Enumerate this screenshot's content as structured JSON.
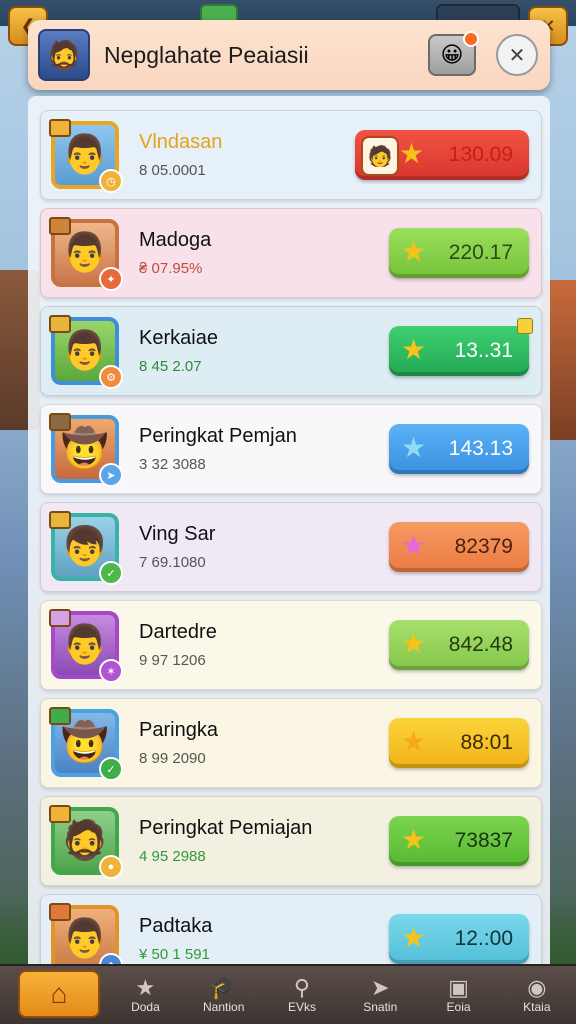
{
  "header": {
    "title": "Nepglahate Peaiasii"
  },
  "colors": {
    "row_blue": "#e6f0f8",
    "row_pink": "#f8e1ea",
    "row_cyan": "#deedf3",
    "row_white": "#f8f8fb",
    "row_lilac": "#f1e8f5",
    "row_cream": "#fbf8ea",
    "row_yellow": "#fbf6e3",
    "row_sand": "#f3f0e2",
    "row_aqua": "#e3eef6",
    "btn_red": "#e8453a",
    "btn_lime": "#8cd44b",
    "btn_green": "#3bc56a",
    "btn_blue": "#4aa3ef",
    "btn_orange": "#f28e55",
    "btn_yellow": "#f9c92b",
    "btn_cyan": "#6fd0e6"
  },
  "players": [
    {
      "name": "Vlndasan",
      "sub": "8 05.0001",
      "score": "130.09",
      "star_icon": "gold-star-icon"
    },
    {
      "name": "Madoga",
      "sub": "₴ 07.95%",
      "score": "220.17",
      "star_icon": "gold-star-icon"
    },
    {
      "name": "Kerkaiae",
      "sub": "8 45 2.07",
      "score": "13..31",
      "star_icon": "gold-star-icon"
    },
    {
      "name": "Peringkat Pemjan",
      "sub": "3 32 3088",
      "score": "143.13",
      "star_icon": "blue-star-icon"
    },
    {
      "name": "Ving Sar",
      "sub": "7 69.1080",
      "score": "82379",
      "star_icon": "pink-star-icon"
    },
    {
      "name": "Dartedre",
      "sub": "9 97 1206",
      "score": "842.48",
      "star_icon": "gold-star-icon"
    },
    {
      "name": "Paringka",
      "sub": "8 99 2090",
      "score": "88:01",
      "star_icon": "gold-star-icon"
    },
    {
      "name": "Peringkat Pemiajan",
      "sub": "4 95 2988",
      "score": "73837",
      "star_icon": "gold-star-icon"
    },
    {
      "name": "Padtaka",
      "sub": "¥ 50 1 591",
      "score": "12.:00",
      "star_icon": "gold-star-icon"
    }
  ],
  "nav": [
    {
      "label": "",
      "icon": "home-icon"
    },
    {
      "label": "Doda",
      "icon": "star-icon"
    },
    {
      "label": "Nantion",
      "icon": "hat-icon"
    },
    {
      "label": "EVks",
      "icon": "search-icon"
    },
    {
      "label": "Snatin",
      "icon": "fish-icon"
    },
    {
      "label": "Eoia",
      "icon": "box-icon"
    },
    {
      "label": "Ktaia",
      "icon": "globe-icon"
    }
  ]
}
